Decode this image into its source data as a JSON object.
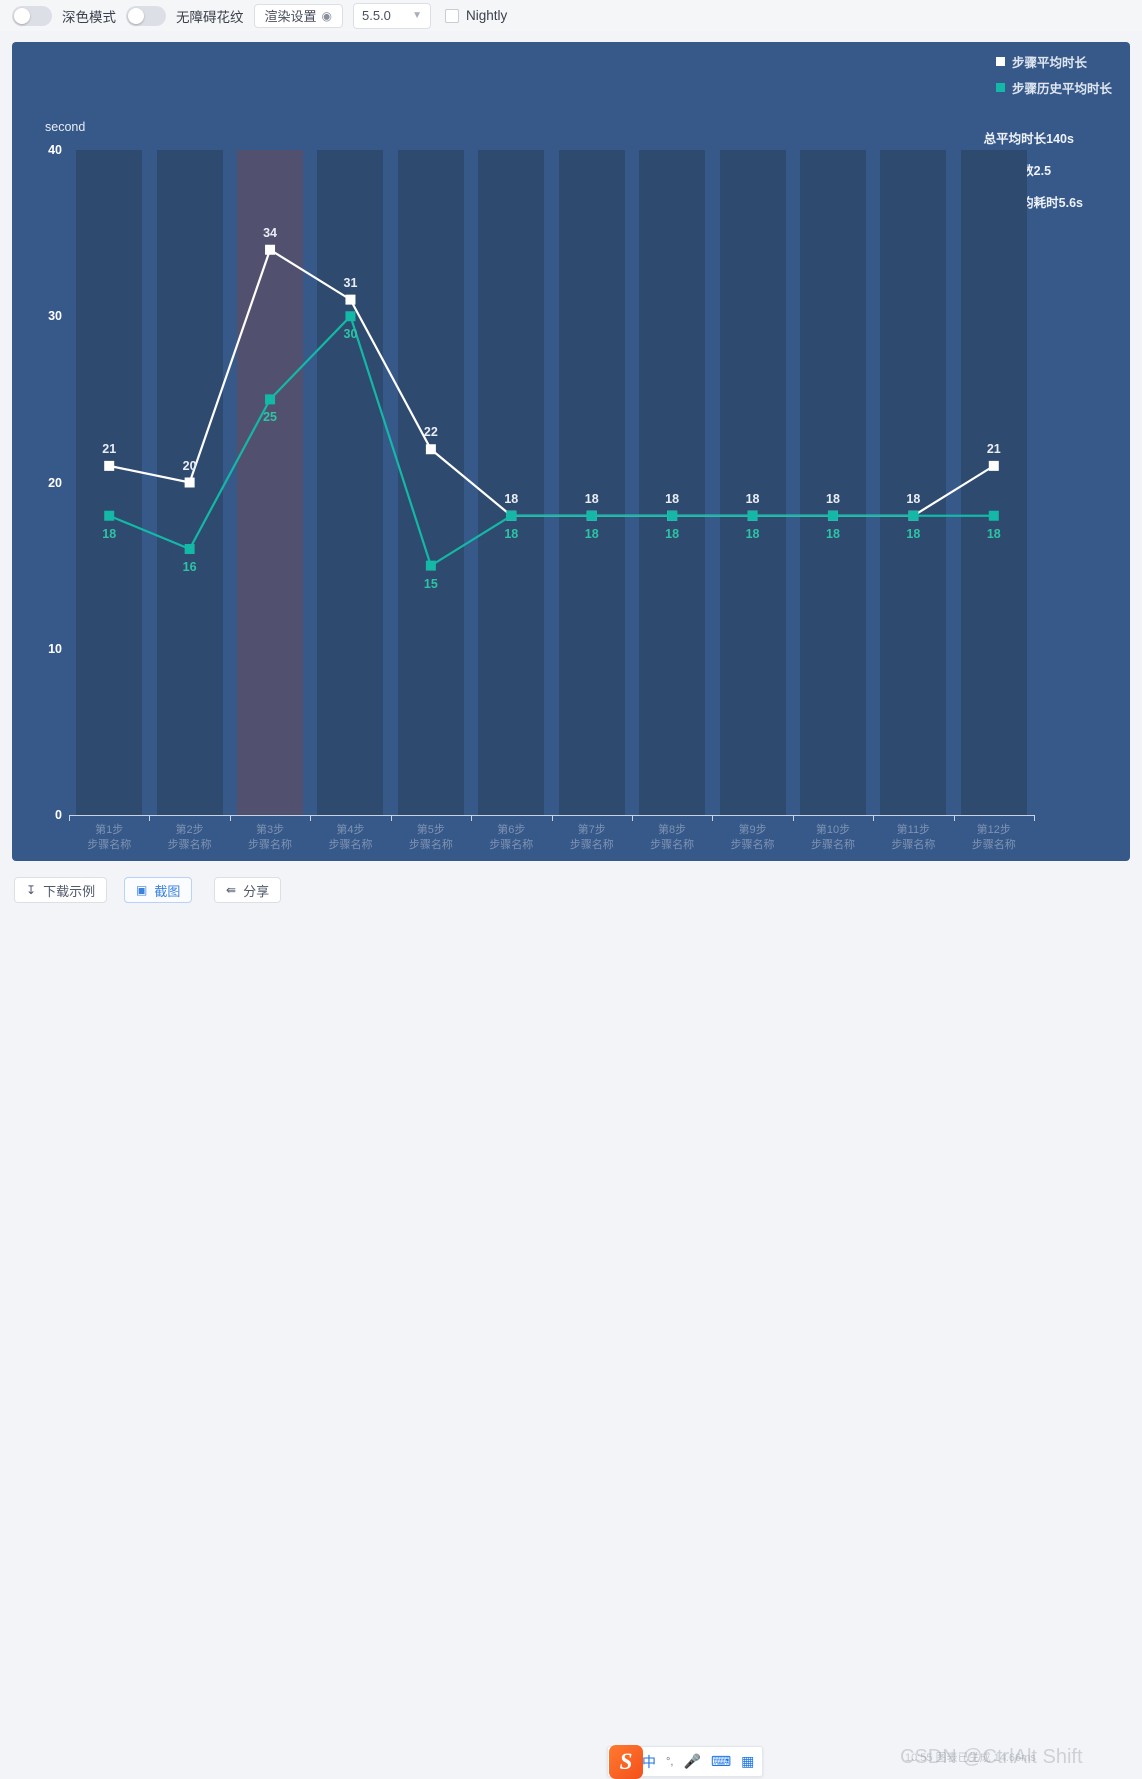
{
  "toolbar": {
    "dark_mode_label": "深色模式",
    "accessibility_label": "无障碍花纹",
    "render_settings_label": "渲染设置",
    "render_settings_icon": "gear-icon",
    "version_value": "5.5.0",
    "chevron_icon": "chevron-down-icon",
    "nightly_label": "Nightly"
  },
  "chart_data": {
    "type": "line",
    "title": "",
    "xlabel": "",
    "ylabel": "second",
    "ylim": [
      0,
      40
    ],
    "yticks": [
      0,
      10,
      20,
      30,
      40
    ],
    "grid": false,
    "legend_position": "top-right",
    "categories": [
      "第1步\n步骤名称",
      "第2步\n步骤名称",
      "第3步\n步骤名称",
      "第4步\n步骤名称",
      "第5步\n步骤名称",
      "第6步\n步骤名称",
      "第7步\n步骤名称",
      "第8步\n步骤名称",
      "第9步\n步骤名称",
      "第10步\n步骤名称",
      "第11步\n步骤名称",
      "第12步\n步骤名称"
    ],
    "category_top": [
      "第1步",
      "第2步",
      "第3步",
      "第4步",
      "第5步",
      "第6步",
      "第7步",
      "第8步",
      "第9步",
      "第10步",
      "第11步",
      "第12步"
    ],
    "category_bottom": "步骤名称",
    "series": [
      {
        "name": "步骤平均时长",
        "color": "#ffffff",
        "values": [
          21,
          20,
          34,
          31,
          22,
          18,
          18,
          18,
          18,
          18,
          18,
          21
        ]
      },
      {
        "name": "步骤历史平均时长",
        "color": "#14b8a6",
        "values": [
          18,
          16,
          25,
          30,
          15,
          18,
          18,
          18,
          18,
          18,
          18,
          18
        ]
      }
    ],
    "highlighted_category_index": 2,
    "annotations": [
      "总平均时长140s",
      "步骤总数2.5",
      "步骤平均耗时5.6s"
    ]
  },
  "datazoom": {
    "start_percent": 0,
    "end_percent": 48.5,
    "tip": "⋯"
  },
  "footer": {
    "download_label": "下载示例",
    "download_icon": "download-icon",
    "screenshot_label": "截图",
    "screenshot_icon": "camera-icon",
    "share_label": "分享",
    "share_icon": "share-icon"
  },
  "ime": {
    "logo_text": "S",
    "mode": "中",
    "punct": "°,",
    "mic_icon": "microphone-icon",
    "keyboard_icon": "keyboard-icon",
    "apps_icon": "apps-grid-icon"
  },
  "watermark": {
    "text": "CSDN @CtrlAlt Shift",
    "sub_text": "10:55  图表已生成 14.66ms"
  },
  "colors": {
    "panel_bg": "#37598a",
    "band": "#2e4a6e",
    "band_highlight": "#52506f",
    "series_white": "#ffffff",
    "series_teal": "#14b8a6",
    "accent_blue": "#4285f4"
  }
}
